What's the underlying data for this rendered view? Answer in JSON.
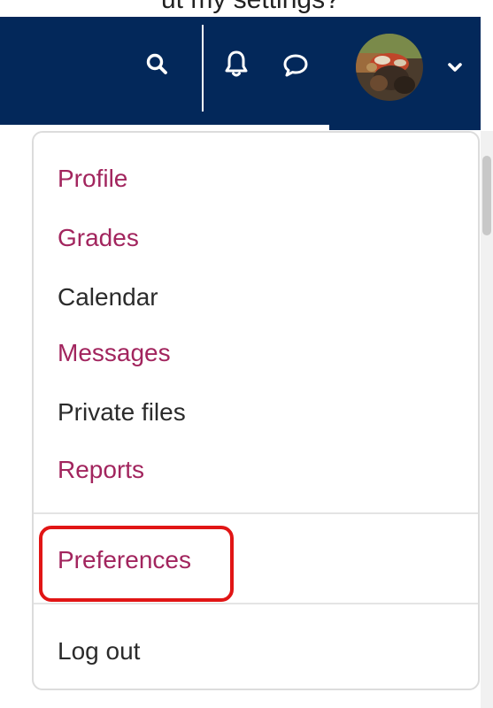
{
  "caption": {
    "text": "ut my settings?"
  },
  "navbar": {
    "search_icon": "search-icon",
    "notifications_icon": "bell-icon",
    "messages_icon": "chat-icon",
    "user_menu_icon": "chevron-down-icon",
    "background_color": "#03285a"
  },
  "user_menu": {
    "items": [
      {
        "label": "Profile"
      },
      {
        "label": "Grades"
      },
      {
        "label": "Calendar"
      },
      {
        "label": "Messages"
      },
      {
        "label": "Private files"
      },
      {
        "label": "Reports"
      },
      {
        "label": "Preferences",
        "highlighted": true
      },
      {
        "label": "Log out"
      }
    ],
    "link_color": "#a2255e",
    "text_color": "#2b2b2b",
    "highlight_color": "#e11515"
  }
}
